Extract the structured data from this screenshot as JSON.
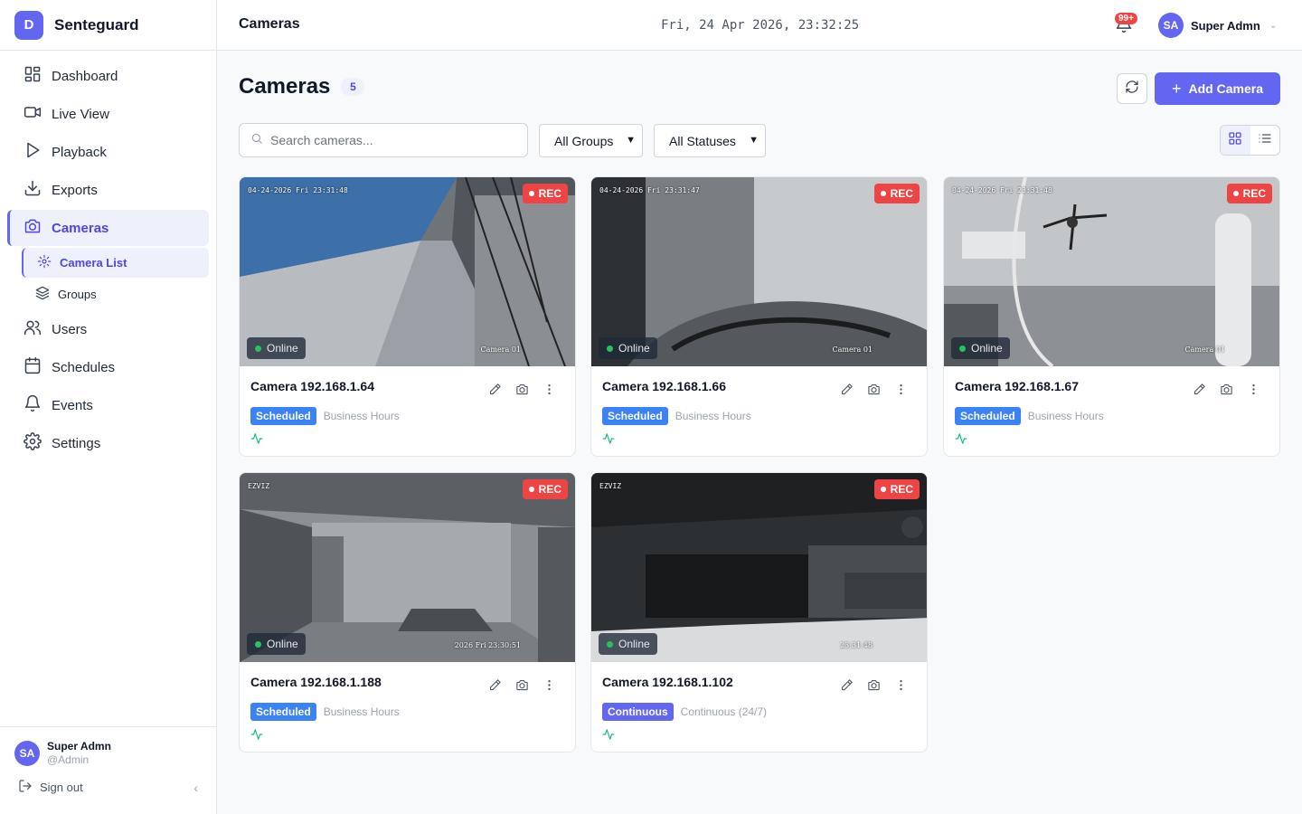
{
  "brand": {
    "logo_letter": "D",
    "name": "Senteguard"
  },
  "sidebar": {
    "items": [
      {
        "label": "Dashboard",
        "icon": "dashboard-icon"
      },
      {
        "label": "Live View",
        "icon": "video-icon"
      },
      {
        "label": "Playback",
        "icon": "play-icon"
      },
      {
        "label": "Exports",
        "icon": "download-icon"
      },
      {
        "label": "Cameras",
        "icon": "camera-icon",
        "active": true
      },
      {
        "label": "Users",
        "icon": "users-icon"
      },
      {
        "label": "Schedules",
        "icon": "calendar-icon"
      },
      {
        "label": "Events",
        "icon": "bell-icon"
      },
      {
        "label": "Settings",
        "icon": "gear-icon"
      }
    ],
    "sub_items": [
      {
        "label": "Camera List",
        "icon": "gear-icon",
        "active": true
      },
      {
        "label": "Groups",
        "icon": "layers-icon"
      }
    ],
    "footer": {
      "avatar": "SA",
      "name": "Super Admn",
      "handle": "@Admin",
      "sign_out": "Sign out",
      "collapse": "‹"
    }
  },
  "topbar": {
    "title": "Cameras",
    "datetime": "Fri, 24 Apr 2026, 23:32:25",
    "notification_badge": "99+",
    "user_avatar": "SA",
    "user_name": "Super Admn"
  },
  "main": {
    "title": "Cameras",
    "count": "5",
    "add_label": "Add Camera",
    "search_placeholder": "Search cameras...",
    "group_filter": "All Groups",
    "status_filter": "All Statuses",
    "view_mode": "grid"
  },
  "colors": {
    "accent": "#6366f1",
    "rec": "#ef4444",
    "online": "#22c55e",
    "scheduled": "#3b82f6",
    "continuous": "#6366f1",
    "pulse": "#10b981"
  },
  "cameras": [
    {
      "name": "Camera 192.168.1.64",
      "rec": "REC",
      "status": "Online",
      "osd_time": "04-24-2026 Fri 23:31:48",
      "osd_name": "Camera 01",
      "mode": "Scheduled",
      "schedule": "Business Hours"
    },
    {
      "name": "Camera 192.168.1.66",
      "rec": "REC",
      "status": "Online",
      "osd_time": "04-24-2026 Fri 23:31:47",
      "osd_name": "Camera 01",
      "mode": "Scheduled",
      "schedule": "Business Hours"
    },
    {
      "name": "Camera 192.168.1.67",
      "rec": "REC",
      "status": "Online",
      "osd_time": "04-24-2026 Fri 23:31:48",
      "osd_name": "Camera 01",
      "mode": "Scheduled",
      "schedule": "Business Hours"
    },
    {
      "name": "Camera 192.168.1.188",
      "rec": "REC",
      "status": "Online",
      "osd_time": "EZVIZ",
      "osd_name": "2026 Fri 23:30:51",
      "mode": "Scheduled",
      "schedule": "Business Hours"
    },
    {
      "name": "Camera 192.168.1.102",
      "rec": "REC",
      "status": "Online",
      "osd_time": "EZVIZ",
      "osd_name": "23:31:48",
      "mode": "Continuous",
      "schedule": "Continuous (24/7)"
    }
  ]
}
